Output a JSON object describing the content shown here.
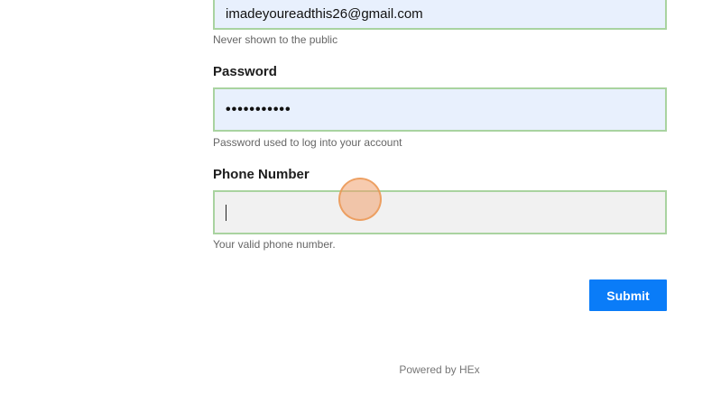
{
  "form": {
    "email": {
      "value": "imadeyoureadthis26@gmail.com",
      "hint": "Never shown to the public"
    },
    "password": {
      "label": "Password",
      "value": "•••••••••••",
      "hint": "Password used to log into your account"
    },
    "phone": {
      "label": "Phone Number",
      "value": "",
      "hint": "Your valid phone number."
    },
    "submit_label": "Submit"
  },
  "footer": {
    "text": "Powered by HEx"
  },
  "colors": {
    "accent": "#0a7cf8",
    "input_border": "#a9d3a0",
    "autofill_bg": "#e8f0fd",
    "cursor_marker": "#f0a06e"
  }
}
